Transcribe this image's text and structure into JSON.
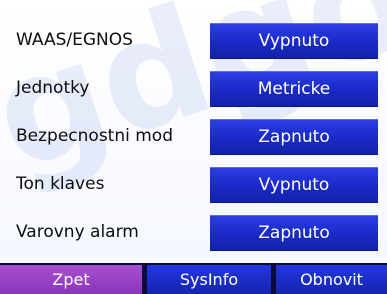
{
  "settings": [
    {
      "label": "WAAS/EGNOS",
      "value": "Vypnuto"
    },
    {
      "label": "Jednotky",
      "value": "Metricke"
    },
    {
      "label": "Bezpecnostni mod",
      "value": "Zapnuto"
    },
    {
      "label": "Ton klaves",
      "value": "Vypnuto"
    },
    {
      "label": "Varovny alarm",
      "value": "Zapnuto"
    }
  ],
  "bottom_bar": {
    "back": "Zpet",
    "sysinfo": "SysInfo",
    "reset": "Obnovit"
  },
  "watermark": "gdgo",
  "colors": {
    "button_blue": "#1a29c6",
    "active_tab": "#8a36b8",
    "bar_background": "#0b0b3a",
    "text": "#0d0d0d"
  }
}
